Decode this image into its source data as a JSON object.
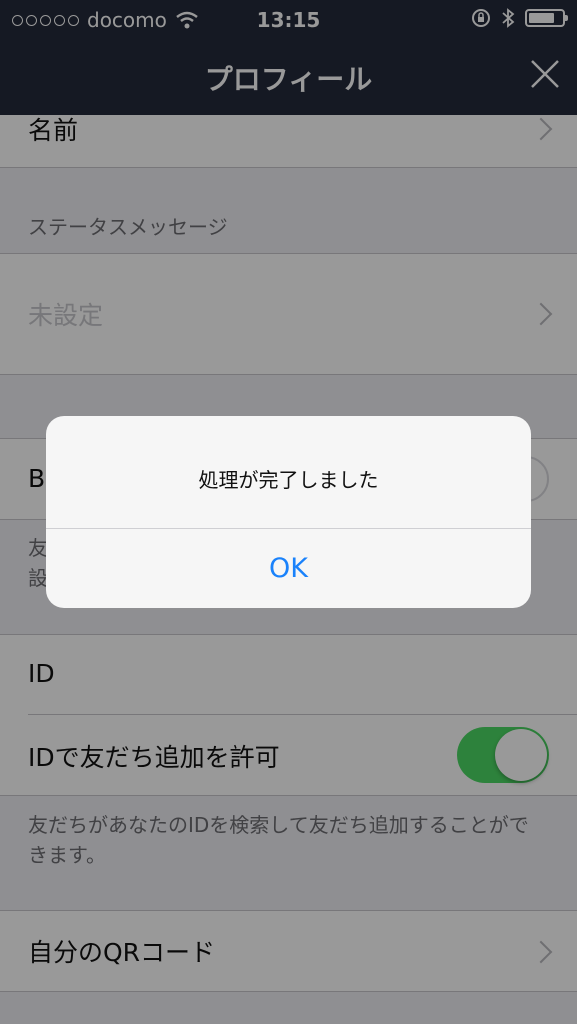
{
  "status_bar": {
    "carrier": "docomo",
    "time": "13:15"
  },
  "nav": {
    "title": "プロフィール"
  },
  "rows": {
    "name": "名前",
    "status_section": "ステータスメッセージ",
    "status_value": "未設定",
    "partial_b": "B",
    "partial_note_1": "友",
    "partial_note_2": "設",
    "id": "ID",
    "allow_id_add": "IDで友だち追加を許可",
    "allow_id_note": "友だちがあなたのIDを検索して友だち追加することができます。",
    "qr_code": "自分のQRコード"
  },
  "alert": {
    "message": "処理が完了しました",
    "ok": "OK"
  },
  "colors": {
    "nav_bg": "#232a3b",
    "toggle_on": "#4cd964",
    "link": "#1a82fb"
  }
}
